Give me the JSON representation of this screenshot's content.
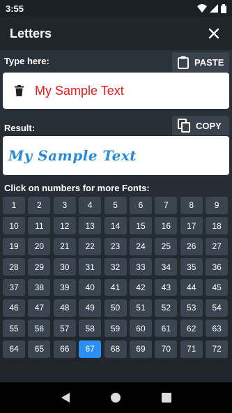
{
  "status_bar": {
    "time": "3:55"
  },
  "app_bar": {
    "title": "Letters"
  },
  "input_section": {
    "label": "Type here:",
    "paste_label": "PASTE",
    "input_value": "My Sample Text"
  },
  "result_section": {
    "label": "Result:",
    "copy_label": "COPY",
    "result_text": "My Sample Text"
  },
  "fonts_section": {
    "label": "Click on numbers for more Fonts:",
    "numbers": [
      "1",
      "2",
      "3",
      "4",
      "5",
      "6",
      "7",
      "8",
      "9",
      "10",
      "11",
      "12",
      "13",
      "14",
      "15",
      "16",
      "17",
      "18",
      "19",
      "20",
      "21",
      "22",
      "23",
      "24",
      "25",
      "26",
      "27",
      "28",
      "29",
      "30",
      "31",
      "32",
      "33",
      "34",
      "35",
      "36",
      "37",
      "38",
      "39",
      "40",
      "41",
      "42",
      "43",
      "44",
      "45",
      "46",
      "47",
      "48",
      "49",
      "50",
      "51",
      "52",
      "53",
      "54",
      "55",
      "56",
      "57",
      "58",
      "59",
      "60",
      "61",
      "62",
      "63",
      "64",
      "65",
      "66",
      "67",
      "68",
      "69",
      "70",
      "71",
      "72"
    ],
    "selected": "67"
  },
  "colors": {
    "accent": "#2a8ff0",
    "input_text": "#e01b1b",
    "result_text": "#2a8ad6",
    "tile": "#3b454f"
  }
}
